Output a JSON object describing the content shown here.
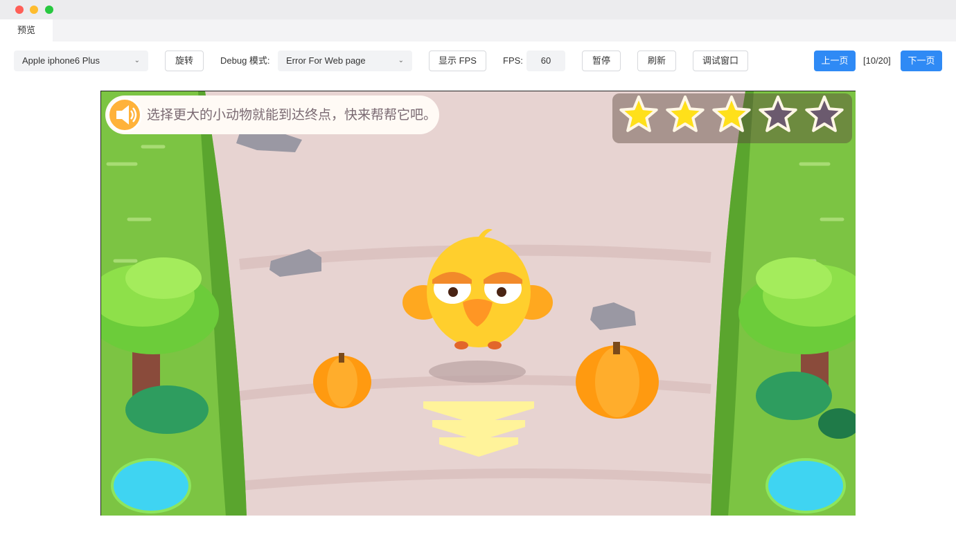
{
  "tab": {
    "label": "预览"
  },
  "toolbar": {
    "device": "Apple iphone6 Plus",
    "rotate_label": "旋转",
    "debug_mode_label": "Debug 模式:",
    "debug_mode_value": "Error For Web page",
    "show_fps_label": "显示 FPS",
    "fps_label": "FPS:",
    "fps_value": "60",
    "pause_label": "暂停",
    "refresh_label": "刷新",
    "debug_window_label": "调试窗口",
    "prev_label": "上一页",
    "page_indicator": "[10/20]",
    "next_label": "下一页"
  },
  "game": {
    "prompt": "选择更大的小动物就能到达终点，快来帮帮它吧。",
    "stars_total": 5,
    "stars_earned": 3,
    "colors": {
      "star_on": "#ffe01a",
      "star_off": "#6b5a6e",
      "grass": "#7cc443",
      "path": "#e7d3d1"
    }
  }
}
